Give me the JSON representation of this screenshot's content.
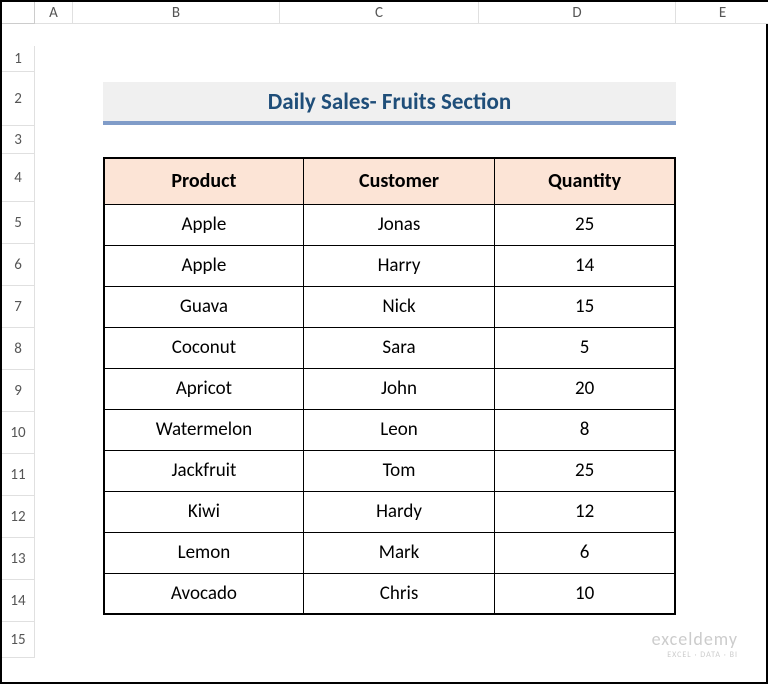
{
  "columns": [
    "",
    "A",
    "B",
    "C",
    "D",
    "E"
  ],
  "rows": [
    "1",
    "2",
    "3",
    "4",
    "5",
    "6",
    "7",
    "8",
    "9",
    "10",
    "11",
    "12",
    "13",
    "14",
    "15"
  ],
  "title": "Daily Sales- Fruits Section",
  "headers": {
    "product": "Product",
    "customer": "Customer",
    "quantity": "Quantity"
  },
  "data": [
    {
      "product": "Apple",
      "customer": "Jonas",
      "quantity": "25"
    },
    {
      "product": "Apple",
      "customer": "Harry",
      "quantity": "14"
    },
    {
      "product": "Guava",
      "customer": "Nick",
      "quantity": "15"
    },
    {
      "product": "Coconut",
      "customer": "Sara",
      "quantity": "5"
    },
    {
      "product": "Apricot",
      "customer": "John",
      "quantity": "20"
    },
    {
      "product": "Watermelon",
      "customer": "Leon",
      "quantity": "8"
    },
    {
      "product": "Jackfruit",
      "customer": "Tom",
      "quantity": "25"
    },
    {
      "product": "Kiwi",
      "customer": "Hardy",
      "quantity": "12"
    },
    {
      "product": "Lemon",
      "customer": "Mark",
      "quantity": "6"
    },
    {
      "product": "Avocado",
      "customer": "Chris",
      "quantity": "10"
    }
  ],
  "watermark": {
    "main": "exceldemy",
    "sub": "EXCEL · DATA · BI"
  }
}
